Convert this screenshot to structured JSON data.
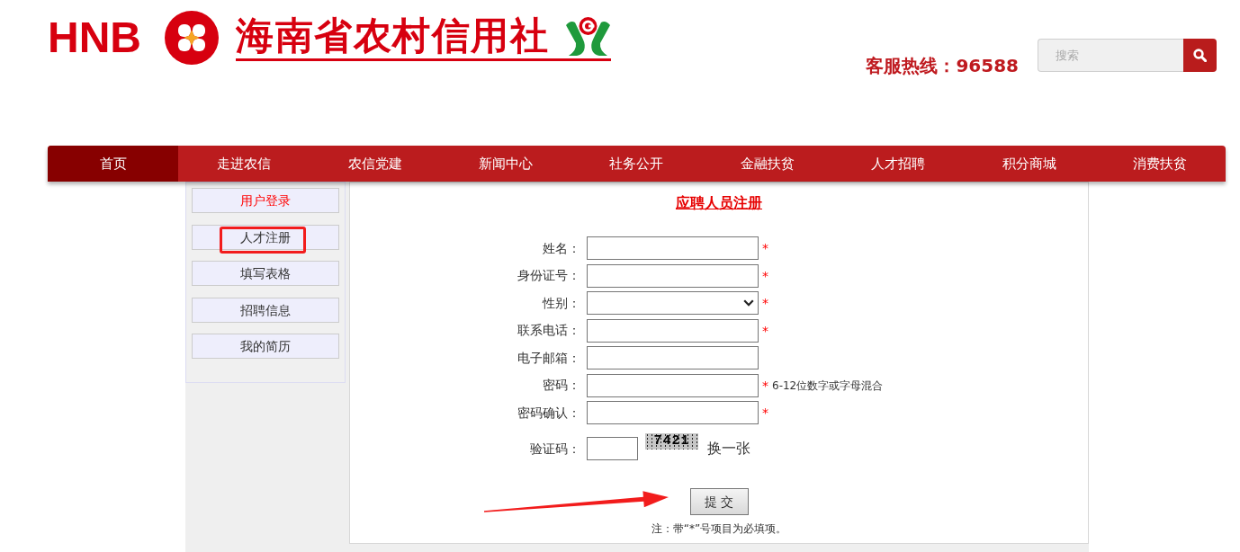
{
  "header": {
    "brand": "HNB",
    "name": "海南省农村信用社",
    "hotline": "客服热线：96588",
    "search": {
      "placeholder": "搜索"
    }
  },
  "nav": [
    {
      "label": "首页",
      "selected": true
    },
    {
      "label": "走进农信",
      "selected": false
    },
    {
      "label": "农信党建",
      "selected": false
    },
    {
      "label": "新闻中心",
      "selected": false
    },
    {
      "label": "社务公开",
      "selected": false
    },
    {
      "label": "金融扶贫",
      "selected": false
    },
    {
      "label": "人才招聘",
      "selected": false
    },
    {
      "label": "积分商城",
      "selected": false
    },
    {
      "label": "消费扶贫",
      "selected": false
    }
  ],
  "sidebar": [
    {
      "label": "用户登录",
      "selected": true,
      "annotated": false
    },
    {
      "label": "人才注册",
      "selected": false,
      "annotated": true
    },
    {
      "label": "填写表格",
      "selected": false,
      "annotated": false
    },
    {
      "label": "招聘信息",
      "selected": false,
      "annotated": false
    },
    {
      "label": "我的简历",
      "selected": false,
      "annotated": false
    }
  ],
  "form": {
    "title": "应聘人员注册",
    "fields": [
      {
        "label": "姓名：",
        "kind": "text",
        "required_mark": "*"
      },
      {
        "label": "身份证号：",
        "kind": "text",
        "required_mark": "*"
      },
      {
        "label": "性别：",
        "kind": "select",
        "required_mark": "*"
      },
      {
        "label": "联系电话：",
        "kind": "text",
        "required_mark": "*"
      },
      {
        "label": "电子邮箱：",
        "kind": "text"
      },
      {
        "label": "密码：",
        "kind": "text",
        "required_mark": "*",
        "hint": "6-12位数字或字母混合"
      },
      {
        "label": "密码确认：",
        "kind": "text",
        "required_mark": "*"
      }
    ],
    "captcha": {
      "label": "验证码：",
      "code": "7421",
      "refresh": "换一张"
    },
    "submit": {
      "label": "提 交",
      "annotated": true
    },
    "note": "注：带“*”号项目为必填项。"
  }
}
